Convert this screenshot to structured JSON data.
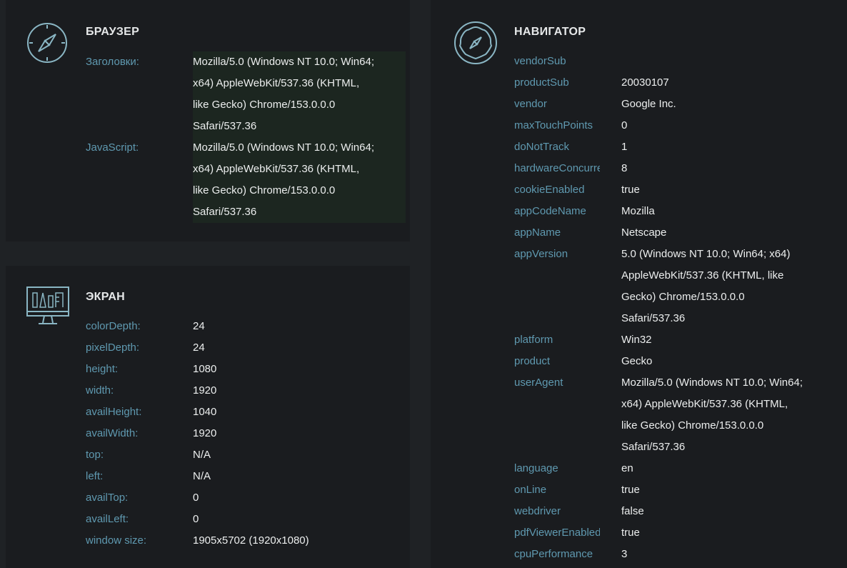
{
  "browser": {
    "title": "БРАУЗЕР",
    "icon": "compass-icon",
    "rows": [
      {
        "key": "Заголовки:",
        "lines": [
          "Mozilla/5.0 (Windows NT 10.0; Win64;",
          "x64) AppleWebKit/537.36 (KHTML,",
          "like Gecko) Chrome/153.0.0.0",
          "Safari/537.36"
        ]
      },
      {
        "key": "JavaScript:",
        "lines": [
          "Mozilla/5.0 (Windows NT 10.0; Win64;",
          "x64) AppleWebKit/537.36 (KHTML,",
          "like Gecko) Chrome/153.0.0.0",
          "Safari/537.36"
        ]
      }
    ]
  },
  "screen": {
    "title": "ЭКРАН",
    "icon": "monitor-design-icon",
    "rows": [
      {
        "key": "colorDepth:",
        "value": "24"
      },
      {
        "key": "pixelDepth:",
        "value": "24"
      },
      {
        "key": "height:",
        "value": "1080"
      },
      {
        "key": "width:",
        "value": "1920"
      },
      {
        "key": "availHeight:",
        "value": "1040"
      },
      {
        "key": "availWidth:",
        "value": "1920"
      },
      {
        "key": "top:",
        "value": "N/A"
      },
      {
        "key": "left:",
        "value": "N/A"
      },
      {
        "key": "availTop:",
        "value": "0"
      },
      {
        "key": "availLeft:",
        "value": "0"
      },
      {
        "key": "window size:",
        "value": "1905x5702 (1920x1080)"
      }
    ]
  },
  "navigator": {
    "title": "НАВИГАТОР",
    "icon": "badge-compass-icon",
    "rows": [
      {
        "key": "vendorSub",
        "lines": [
          ""
        ]
      },
      {
        "key": "productSub",
        "lines": [
          "20030107"
        ]
      },
      {
        "key": "vendor",
        "lines": [
          "Google Inc."
        ]
      },
      {
        "key": "maxTouchPoints",
        "lines": [
          "0"
        ]
      },
      {
        "key": "doNotTrack",
        "lines": [
          "1"
        ]
      },
      {
        "key": "hardwareConcurrency",
        "lines": [
          "8"
        ]
      },
      {
        "key": "cookieEnabled",
        "lines": [
          "true"
        ]
      },
      {
        "key": "appCodeName",
        "lines": [
          "Mozilla"
        ]
      },
      {
        "key": "appName",
        "lines": [
          "Netscape"
        ]
      },
      {
        "key": "appVersion",
        "lines": [
          "5.0 (Windows NT 10.0; Win64; x64)",
          "AppleWebKit/537.36 (KHTML, like",
          "Gecko) Chrome/153.0.0.0",
          "Safari/537.36"
        ]
      },
      {
        "key": "platform",
        "lines": [
          "Win32"
        ]
      },
      {
        "key": "product",
        "lines": [
          "Gecko"
        ]
      },
      {
        "key": "userAgent",
        "lines": [
          "Mozilla/5.0 (Windows NT 10.0; Win64;",
          "x64) AppleWebKit/537.36 (KHTML,",
          "like Gecko) Chrome/153.0.0.0",
          "Safari/537.36"
        ]
      },
      {
        "key": "language",
        "lines": [
          "en"
        ]
      },
      {
        "key": "onLine",
        "lines": [
          "true"
        ]
      },
      {
        "key": "webdriver",
        "lines": [
          "false"
        ]
      },
      {
        "key": "pdfViewerEnabled",
        "lines": [
          "true"
        ]
      },
      {
        "key": "cpuPerformance",
        "lines": [
          "3"
        ]
      }
    ]
  },
  "colors": {
    "page_bg": "#1f2225",
    "panel_bg": "#1a1c1f",
    "key_text": "#5f99b0",
    "value_text": "#eceeee",
    "icon_stroke": "#8ab6c4"
  }
}
